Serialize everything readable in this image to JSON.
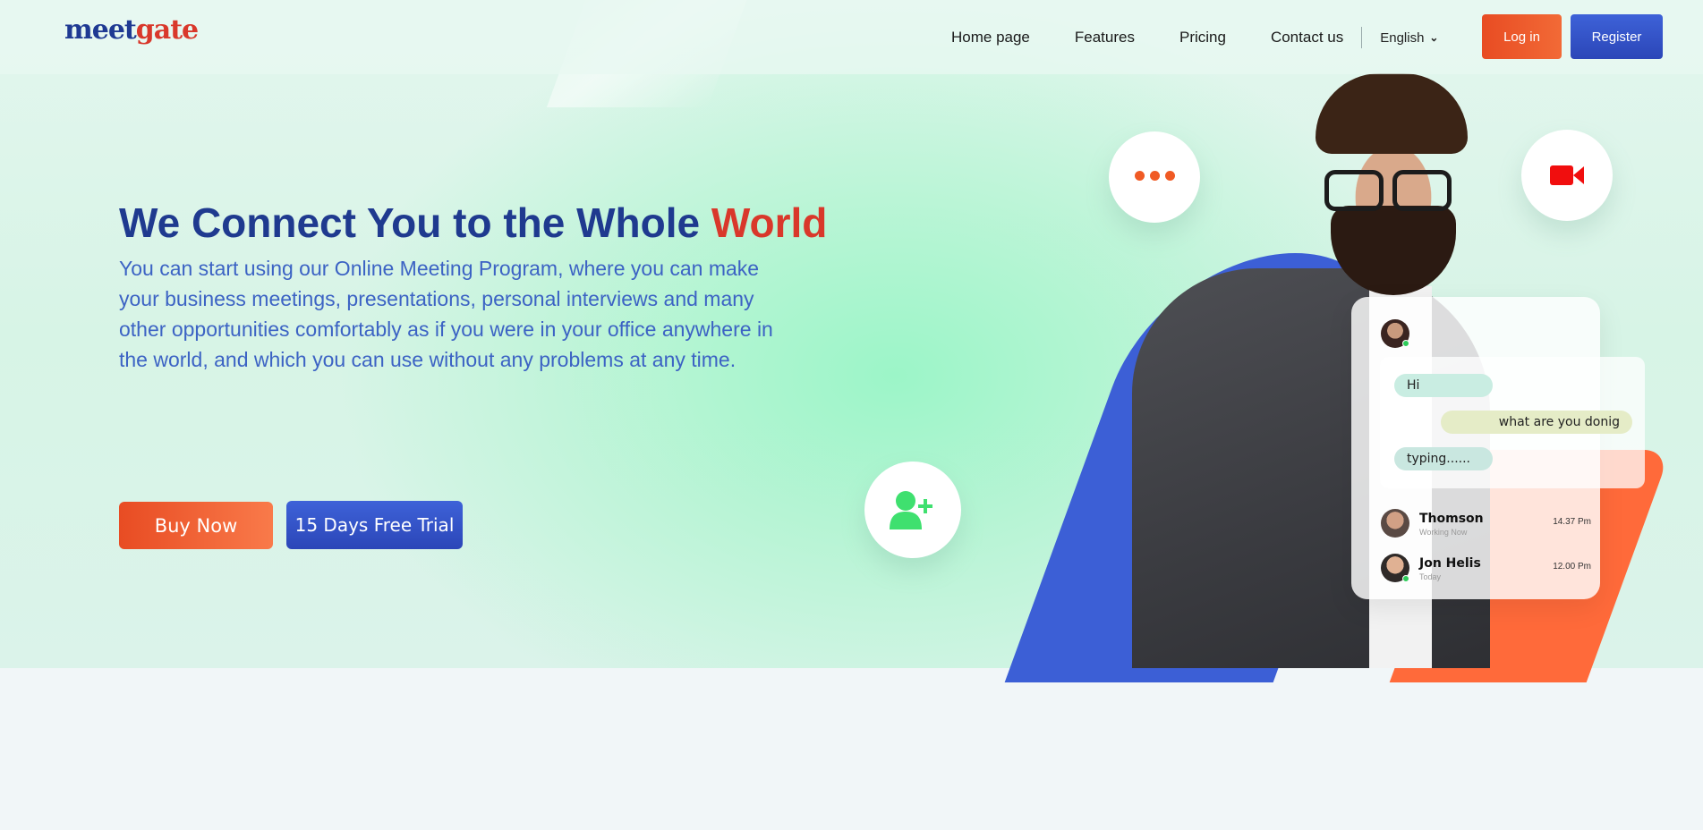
{
  "header": {
    "logo_part1": "meet",
    "logo_part2": "gate",
    "nav": [
      "Home page",
      "Features",
      "Pricing",
      "Contact us"
    ],
    "language": "English",
    "login_label": "Log in",
    "register_label": "Register"
  },
  "hero": {
    "title_main": "We Connect You to the Whole ",
    "title_accent": "World",
    "description": "You can start using our Online Meeting Program, where you can make your business meetings, presentations, personal interviews and many other opportunities comfortably as if you were in your office anywhere in the world, and which you can use without any problems at any time.",
    "buy_label": "Buy Now",
    "trial_label": "15 Days Free Trial"
  },
  "chat": {
    "messages": [
      "Hi",
      "what are you donig",
      "typing......"
    ],
    "contacts": [
      {
        "name": "Thomson",
        "status": "Working Now",
        "time": "14.37 Pm"
      },
      {
        "name": "Jon Helis",
        "status": "Today",
        "time": "12.00 Pm"
      }
    ]
  },
  "colors": {
    "brand_blue": "#1f3a8f",
    "accent_red": "#d9382b",
    "button_orange": "#e84c23",
    "button_blue": "#2b46b8"
  },
  "icons": [
    "more-dots-icon",
    "video-camera-icon",
    "add-user-icon",
    "chevron-down-icon"
  ]
}
